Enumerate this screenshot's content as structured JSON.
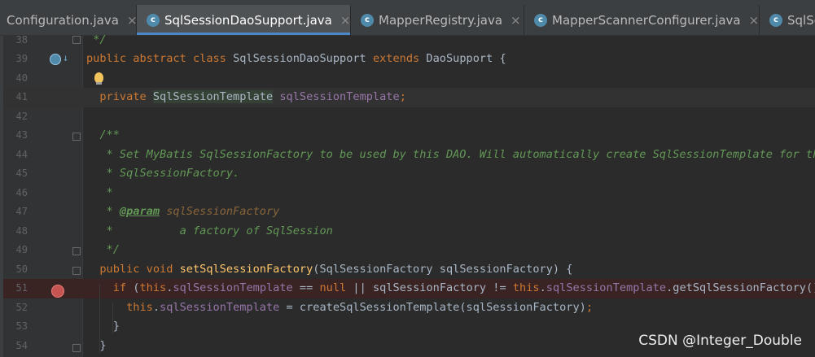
{
  "tabs": [
    {
      "label": "Configuration.java",
      "active": false,
      "icon": "class-icon"
    },
    {
      "label": "SqlSessionDaoSupport.java",
      "active": true,
      "icon": "class-icon"
    },
    {
      "label": "MapperRegistry.java",
      "active": false,
      "icon": "class-icon"
    },
    {
      "label": "MapperScannerConfigurer.java",
      "active": false,
      "icon": "class-icon"
    },
    {
      "label": "SqlSe",
      "active": false,
      "icon": "class-icon"
    }
  ],
  "close_glyph": "×",
  "lines": [
    {
      "num": "38",
      "tokens": [
        {
          "t": " */",
          "c": "cm"
        }
      ]
    },
    {
      "num": "39",
      "tokens": [
        {
          "t": "public abstract class ",
          "c": "kw"
        },
        {
          "t": "SqlSessionDaoSupport ",
          "c": ""
        },
        {
          "t": "extends ",
          "c": "kw"
        },
        {
          "t": "DaoSupport {",
          "c": ""
        }
      ]
    },
    {
      "num": "40",
      "tokens": []
    },
    {
      "num": "41",
      "tokens": [
        {
          "t": "  private ",
          "c": "kw"
        },
        {
          "t": "SqlSessionTemplate",
          "c": "typehl"
        },
        {
          "t": " ",
          "c": ""
        },
        {
          "t": "sqlSessionTemplate",
          "c": "fld"
        },
        {
          "t": ";",
          "c": "kw"
        }
      ]
    },
    {
      "num": "42",
      "tokens": []
    },
    {
      "num": "43",
      "tokens": [
        {
          "t": "  /**",
          "c": "cm"
        }
      ]
    },
    {
      "num": "44",
      "tokens": [
        {
          "t": "   * Set MyBatis SqlSessionFactory to be used by this DAO. Will automatically create SqlSessionTemplate for the",
          "c": "cm"
        }
      ]
    },
    {
      "num": "45",
      "tokens": [
        {
          "t": "   * SqlSessionFactory.",
          "c": "cm"
        }
      ]
    },
    {
      "num": "46",
      "tokens": [
        {
          "t": "   *",
          "c": "cm"
        }
      ]
    },
    {
      "num": "47",
      "tokens": [
        {
          "t": "   * ",
          "c": "cm"
        },
        {
          "t": "@param",
          "c": "tagp"
        },
        {
          "t": " ",
          "c": "cm"
        },
        {
          "t": "sqlSessionFactory",
          "c": "pvar"
        }
      ]
    },
    {
      "num": "48",
      "tokens": [
        {
          "t": "   *          a factory of SqlSession",
          "c": "cm"
        }
      ]
    },
    {
      "num": "49",
      "tokens": [
        {
          "t": "   */",
          "c": "cm"
        }
      ]
    },
    {
      "num": "50",
      "tokens": [
        {
          "t": "  public void ",
          "c": "kw"
        },
        {
          "t": "setSqlSessionFactory",
          "c": "fn"
        },
        {
          "t": "(SqlSessionFactory sqlSessionFactory) {",
          "c": ""
        }
      ]
    },
    {
      "num": "51",
      "tokens": [
        {
          "t": "    if ",
          "c": "kw"
        },
        {
          "t": "(",
          "c": ""
        },
        {
          "t": "this",
          "c": "kw"
        },
        {
          "t": ".",
          "c": ""
        },
        {
          "t": "sqlSessionTemplate",
          "c": "fld"
        },
        {
          "t": " == ",
          "c": ""
        },
        {
          "t": "null",
          "c": "kw"
        },
        {
          "t": " || sqlSessionFactory != ",
          "c": ""
        },
        {
          "t": "this",
          "c": "kw"
        },
        {
          "t": ".",
          "c": ""
        },
        {
          "t": "sqlSessionTemplate",
          "c": "fld"
        },
        {
          "t": ".getSqlSessionFactory()) {",
          "c": ""
        }
      ]
    },
    {
      "num": "52",
      "tokens": [
        {
          "t": "      this",
          "c": "kw"
        },
        {
          "t": ".",
          "c": ""
        },
        {
          "t": "sqlSessionTemplate",
          "c": "fld"
        },
        {
          "t": " = createSqlSessionTemplate(sqlSessionFactory)",
          "c": ""
        },
        {
          "t": ";",
          "c": "kw"
        }
      ]
    },
    {
      "num": "53",
      "tokens": [
        {
          "t": "    }",
          "c": ""
        }
      ]
    },
    {
      "num": "54",
      "tokens": [
        {
          "t": "  }",
          "c": ""
        }
      ]
    }
  ],
  "watermark": "CSDN @Integer_Double"
}
